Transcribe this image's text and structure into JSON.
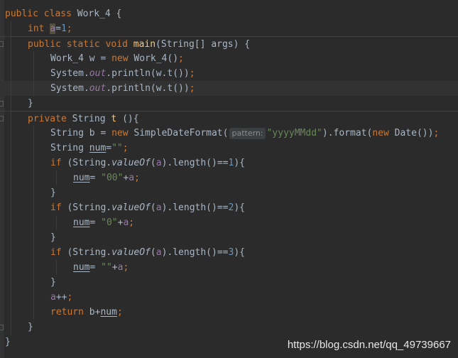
{
  "editor": {
    "lines": [
      {
        "indent": 0,
        "tokens": [
          {
            "t": "public",
            "c": "kw"
          },
          {
            "t": " "
          },
          {
            "t": "class",
            "c": "kw"
          },
          {
            "t": " Work_4 {"
          }
        ]
      },
      {
        "indent": 1,
        "tokens": [
          {
            "t": "int",
            "c": "kw"
          },
          {
            "t": " "
          },
          {
            "t": "a",
            "c": "fld hl"
          },
          {
            "t": "="
          },
          {
            "t": "1",
            "c": "num"
          },
          {
            "t": ";",
            "c": "kw"
          }
        ]
      },
      {
        "indent": 1,
        "sep": true,
        "tokens": [
          {
            "t": "public",
            "c": "kw"
          },
          {
            "t": " "
          },
          {
            "t": "static",
            "c": "kw"
          },
          {
            "t": " "
          },
          {
            "t": "void",
            "c": "kw"
          },
          {
            "t": " "
          },
          {
            "t": "main",
            "c": "fn"
          },
          {
            "t": "(String[] args) {"
          }
        ]
      },
      {
        "indent": 2,
        "tokens": [
          {
            "t": "Work_4 w = "
          },
          {
            "t": "new",
            "c": "kw"
          },
          {
            "t": " Work_4()"
          },
          {
            "t": ";",
            "c": "kw"
          }
        ]
      },
      {
        "indent": 2,
        "tokens": [
          {
            "t": "System."
          },
          {
            "t": "out",
            "c": "sfld"
          },
          {
            "t": ".println(w.t())"
          },
          {
            "t": ";",
            "c": "kw"
          }
        ]
      },
      {
        "indent": 2,
        "current": true,
        "tokens": [
          {
            "t": "System."
          },
          {
            "t": "out",
            "c": "sfld"
          },
          {
            "t": ".println(w.t())"
          },
          {
            "t": ";",
            "c": "kw"
          }
        ]
      },
      {
        "indent": 1,
        "tokens": [
          {
            "t": "}"
          }
        ]
      },
      {
        "indent": 1,
        "sep": true,
        "tokens": [
          {
            "t": "private",
            "c": "kw"
          },
          {
            "t": " String "
          },
          {
            "t": "t",
            "c": "fn"
          },
          {
            "t": " (){"
          }
        ]
      },
      {
        "indent": 2,
        "tokens": [
          {
            "t": "String b = "
          },
          {
            "t": "new",
            "c": "kw"
          },
          {
            "t": " SimpleDateFormat("
          },
          {
            "t": "pattern:",
            "c": "hint"
          },
          {
            "t": "\"yyyyMMdd\"",
            "c": "str"
          },
          {
            "t": ").format("
          },
          {
            "t": "new",
            "c": "kw"
          },
          {
            "t": " Date())"
          },
          {
            "t": ";",
            "c": "kw"
          }
        ]
      },
      {
        "indent": 2,
        "tokens": [
          {
            "t": "String "
          },
          {
            "t": "num",
            "c": "ul"
          },
          {
            "t": "="
          },
          {
            "t": "\"\"",
            "c": "str"
          },
          {
            "t": ";",
            "c": "kw"
          }
        ]
      },
      {
        "indent": 2,
        "tokens": [
          {
            "t": "if",
            "c": "kw"
          },
          {
            "t": " (String."
          },
          {
            "t": "valueOf",
            "c": "smeth"
          },
          {
            "t": "("
          },
          {
            "t": "a",
            "c": "fld"
          },
          {
            "t": ").length()=="
          },
          {
            "t": "1",
            "c": "num"
          },
          {
            "t": "){"
          }
        ]
      },
      {
        "indent": 3,
        "tokens": [
          {
            "t": "num",
            "c": "ul"
          },
          {
            "t": "= "
          },
          {
            "t": "\"00\"",
            "c": "str"
          },
          {
            "t": "+"
          },
          {
            "t": "a",
            "c": "fld"
          },
          {
            "t": ";",
            "c": "kw"
          }
        ]
      },
      {
        "indent": 2,
        "tokens": [
          {
            "t": "}"
          }
        ]
      },
      {
        "indent": 2,
        "tokens": [
          {
            "t": "if",
            "c": "kw"
          },
          {
            "t": " (String."
          },
          {
            "t": "valueOf",
            "c": "smeth"
          },
          {
            "t": "("
          },
          {
            "t": "a",
            "c": "fld"
          },
          {
            "t": ").length()=="
          },
          {
            "t": "2",
            "c": "num"
          },
          {
            "t": "){"
          }
        ]
      },
      {
        "indent": 3,
        "tokens": [
          {
            "t": "num",
            "c": "ul"
          },
          {
            "t": "= "
          },
          {
            "t": "\"0\"",
            "c": "str"
          },
          {
            "t": "+"
          },
          {
            "t": "a",
            "c": "fld"
          },
          {
            "t": ";",
            "c": "kw"
          }
        ]
      },
      {
        "indent": 2,
        "tokens": [
          {
            "t": "}"
          }
        ]
      },
      {
        "indent": 2,
        "tokens": [
          {
            "t": "if",
            "c": "kw"
          },
          {
            "t": " (String."
          },
          {
            "t": "valueOf",
            "c": "smeth"
          },
          {
            "t": "("
          },
          {
            "t": "a",
            "c": "fld"
          },
          {
            "t": ").length()=="
          },
          {
            "t": "3",
            "c": "num"
          },
          {
            "t": "){"
          }
        ]
      },
      {
        "indent": 3,
        "tokens": [
          {
            "t": "num",
            "c": "ul"
          },
          {
            "t": "= "
          },
          {
            "t": "\"\"",
            "c": "str"
          },
          {
            "t": "+"
          },
          {
            "t": "a",
            "c": "fld"
          },
          {
            "t": ";",
            "c": "kw"
          }
        ]
      },
      {
        "indent": 2,
        "tokens": [
          {
            "t": "}"
          }
        ]
      },
      {
        "indent": 2,
        "tokens": [
          {
            "t": "a",
            "c": "fld"
          },
          {
            "t": "++"
          },
          {
            "t": ";",
            "c": "kw"
          }
        ]
      },
      {
        "indent": 2,
        "tokens": [
          {
            "t": "return",
            "c": "kw"
          },
          {
            "t": " b+"
          },
          {
            "t": "num",
            "c": "ul"
          },
          {
            "t": ";",
            "c": "kw"
          }
        ]
      },
      {
        "indent": 1,
        "tokens": [
          {
            "t": "}"
          }
        ]
      },
      {
        "indent": 0,
        "tokens": [
          {
            "t": "}"
          }
        ]
      }
    ]
  },
  "watermark": "https://blog.csdn.net/qq_49739667",
  "colors": {
    "background": "#2b2b2b",
    "keyword": "#cc7832",
    "method": "#ffc66d",
    "string": "#6a8759",
    "number": "#6897bb",
    "field": "#9876aa",
    "text": "#a9b7c6"
  }
}
